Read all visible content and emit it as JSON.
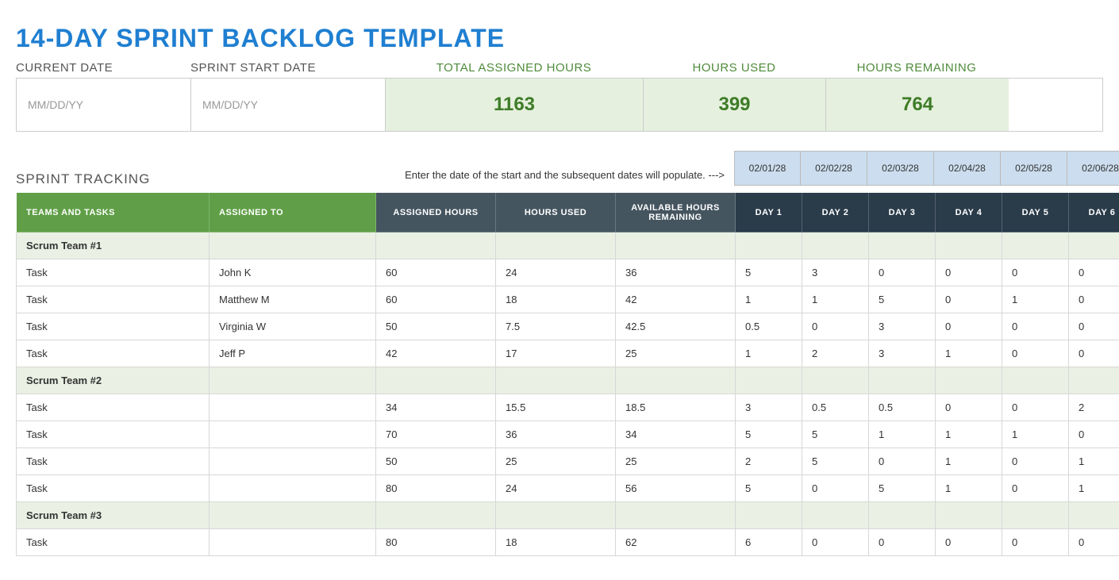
{
  "title": "14-DAY SPRINT BACKLOG TEMPLATE",
  "summary": {
    "labels": {
      "current_date": "CURRENT DATE",
      "sprint_start": "SPRINT START DATE",
      "total_assigned": "TOTAL ASSIGNED HOURS",
      "hours_used": "HOURS USED",
      "hours_remaining": "HOURS REMAINING"
    },
    "placeholders": {
      "current_date": "MM/DD/YY",
      "sprint_start": "MM/DD/YY"
    },
    "metrics": {
      "total_assigned": "1163",
      "hours_used": "399",
      "hours_remaining": "764"
    }
  },
  "hint": "Enter the date of the start and the subsequent dates will populate.  --->",
  "section_label": "SPRINT TRACKING",
  "dates": [
    "02/01/28",
    "02/02/28",
    "02/03/28",
    "02/04/28",
    "02/05/28",
    "02/06/28"
  ],
  "headers": {
    "teams": "TEAMS AND TASKS",
    "assigned_to": "ASSIGNED TO",
    "assigned_hours": "ASSIGNED HOURS",
    "hours_used": "HOURS USED",
    "available": "AVAILABLE HOURS REMAINING",
    "days": [
      "DAY 1",
      "DAY 2",
      "DAY 3",
      "DAY 4",
      "DAY 5",
      "DAY 6"
    ]
  },
  "rows": [
    {
      "type": "team",
      "task": "Scrum Team #1"
    },
    {
      "type": "task",
      "task": "Task",
      "assignee": "John K",
      "ah": "60",
      "hu": "24",
      "rem": "36",
      "d": [
        "5",
        "3",
        "0",
        "0",
        "0",
        "0"
      ]
    },
    {
      "type": "task",
      "task": "Task",
      "assignee": "Matthew M",
      "ah": "60",
      "hu": "18",
      "rem": "42",
      "d": [
        "1",
        "1",
        "5",
        "0",
        "1",
        "0"
      ]
    },
    {
      "type": "task",
      "task": "Task",
      "assignee": "Virginia W",
      "ah": "50",
      "hu": "7.5",
      "rem": "42.5",
      "d": [
        "0.5",
        "0",
        "3",
        "0",
        "0",
        "0"
      ]
    },
    {
      "type": "task",
      "task": "Task",
      "assignee": "Jeff P",
      "ah": "42",
      "hu": "17",
      "rem": "25",
      "d": [
        "1",
        "2",
        "3",
        "1",
        "0",
        "0"
      ]
    },
    {
      "type": "team",
      "task": "Scrum Team #2"
    },
    {
      "type": "task",
      "task": "Task",
      "assignee": "",
      "ah": "34",
      "hu": "15.5",
      "rem": "18.5",
      "d": [
        "3",
        "0.5",
        "0.5",
        "0",
        "0",
        "2"
      ]
    },
    {
      "type": "task",
      "task": "Task",
      "assignee": "",
      "ah": "70",
      "hu": "36",
      "rem": "34",
      "d": [
        "5",
        "5",
        "1",
        "1",
        "1",
        "0"
      ]
    },
    {
      "type": "task",
      "task": "Task",
      "assignee": "",
      "ah": "50",
      "hu": "25",
      "rem": "25",
      "d": [
        "2",
        "5",
        "0",
        "1",
        "0",
        "1"
      ]
    },
    {
      "type": "task",
      "task": "Task",
      "assignee": "",
      "ah": "80",
      "hu": "24",
      "rem": "56",
      "d": [
        "5",
        "0",
        "5",
        "1",
        "0",
        "1"
      ]
    },
    {
      "type": "team",
      "task": "Scrum Team #3"
    },
    {
      "type": "task",
      "task": "Task",
      "assignee": "",
      "ah": "80",
      "hu": "18",
      "rem": "62",
      "d": [
        "6",
        "0",
        "0",
        "0",
        "0",
        "0"
      ]
    }
  ]
}
